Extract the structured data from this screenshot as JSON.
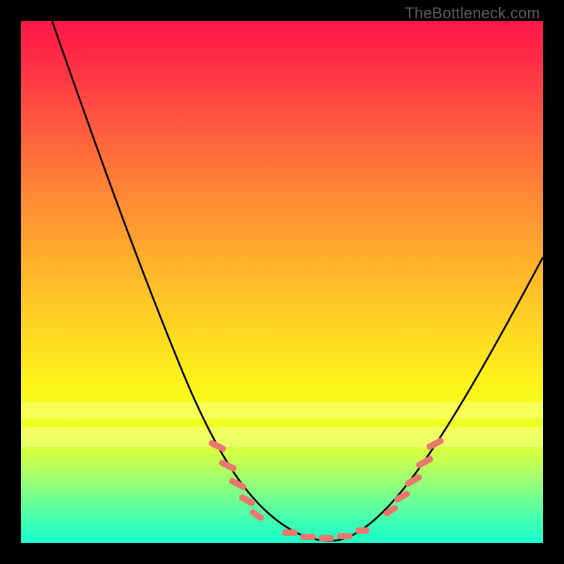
{
  "watermark": "TheBottleneck.com",
  "chart_data": {
    "type": "line",
    "title": "",
    "xlabel": "",
    "ylabel": "",
    "xlim": [
      0,
      100
    ],
    "ylim": [
      0,
      100
    ],
    "grid": false,
    "legend": false,
    "series": [
      {
        "name": "bottleneck-curve",
        "x": [
          0,
          5,
          10,
          15,
          20,
          25,
          30,
          35,
          40,
          45,
          50,
          53,
          56,
          59,
          62,
          65,
          70,
          75,
          80,
          85,
          90,
          95,
          100
        ],
        "values": [
          100,
          90,
          80,
          70,
          60,
          50,
          40,
          31,
          22,
          14,
          7,
          4,
          2,
          1,
          1,
          2,
          6,
          12,
          20,
          29,
          38,
          47,
          56
        ]
      }
    ],
    "markers": [
      {
        "name": "left-band",
        "x_range": [
          38,
          48
        ],
        "y_range": [
          14,
          26
        ],
        "color": "#e8786d"
      },
      {
        "name": "bottom-band",
        "x_range": [
          51,
          64
        ],
        "y_range": [
          0,
          3
        ],
        "color": "#e8786d"
      },
      {
        "name": "right-band",
        "x_range": [
          68,
          76
        ],
        "y_range": [
          10,
          22
        ],
        "color": "#e8786d"
      }
    ],
    "overlay_bands": [
      {
        "name": "yellow-band-1",
        "y_range": [
          24,
          27
        ]
      },
      {
        "name": "yellow-band-2",
        "y_range": [
          18,
          22
        ]
      }
    ]
  }
}
